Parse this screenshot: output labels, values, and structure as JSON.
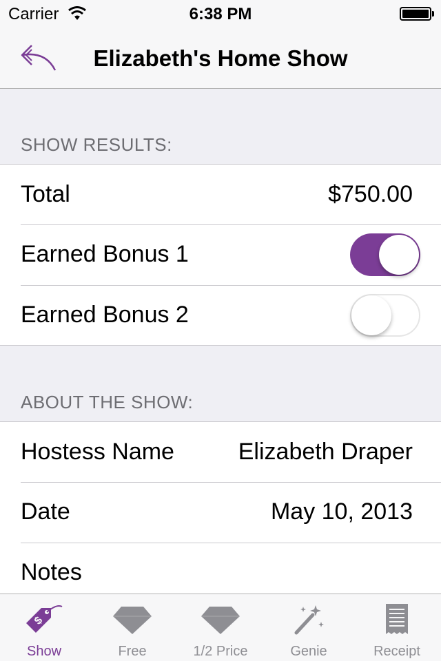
{
  "status_bar": {
    "carrier": "Carrier",
    "time": "6:38 PM"
  },
  "nav": {
    "title": "Elizabeth's Home Show",
    "back_icon": "reply-arrow-icon"
  },
  "show_results": {
    "header": "SHOW RESULTS:",
    "total_label": "Total",
    "total_value": "$750.00",
    "bonus1_label": "Earned Bonus 1",
    "bonus1_on": true,
    "bonus2_label": "Earned Bonus 2",
    "bonus2_on": false
  },
  "about": {
    "header": "ABOUT THE SHOW:",
    "hostess_label": "Hostess Name",
    "hostess_value": "Elizabeth Draper",
    "date_label": "Date",
    "date_value": "May 10, 2013",
    "notes_label": "Notes"
  },
  "tabs": [
    {
      "label": "Show",
      "icon": "price-tag-icon",
      "active": true
    },
    {
      "label": "Free",
      "icon": "diamond-icon",
      "active": false
    },
    {
      "label": "1/2 Price",
      "icon": "diamond-icon",
      "active": false
    },
    {
      "label": "Genie",
      "icon": "magic-wand-icon",
      "active": false
    },
    {
      "label": "Receipt",
      "icon": "receipt-icon",
      "active": false
    }
  ],
  "colors": {
    "accent": "#7b3d96",
    "inactive": "#8e8e93",
    "background": "#efeff4"
  }
}
